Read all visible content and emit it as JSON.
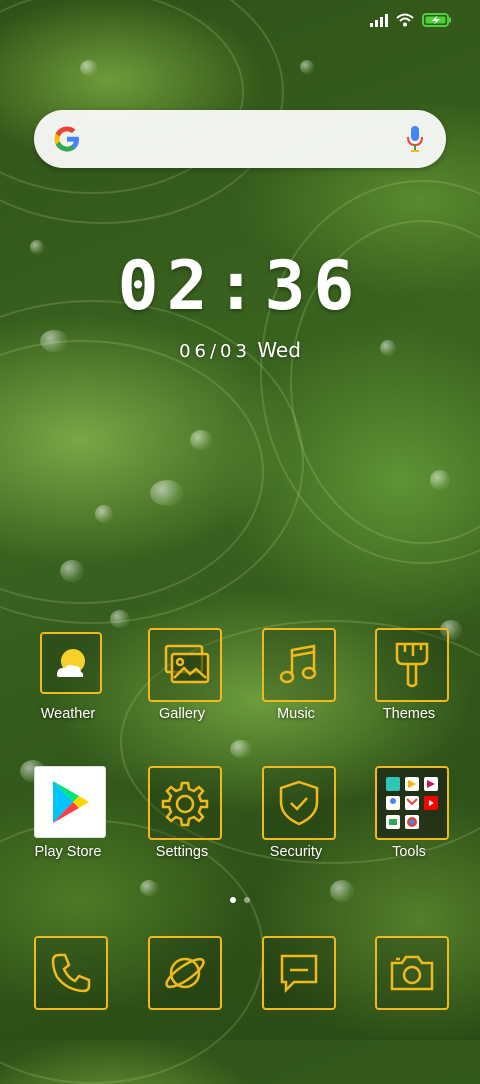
{
  "status": {
    "signal_icon": "signal-bars-icon",
    "wifi_icon": "wifi-icon",
    "battery_icon": "battery-charging-icon",
    "battery_color": "#4cd137"
  },
  "search": {
    "logo_icon": "google-g-icon",
    "mic_icon": "microphone-icon"
  },
  "clock": {
    "time": "02:36",
    "date": "06/03",
    "weekday": "Wed"
  },
  "accent": "#f3b91b",
  "apps_row1": [
    {
      "label": "Weather",
      "icon": "weather-sun-cloud-icon"
    },
    {
      "label": "Gallery",
      "icon": "gallery-images-icon"
    },
    {
      "label": "Music",
      "icon": "music-note-icon"
    },
    {
      "label": "Themes",
      "icon": "paintbrush-icon"
    }
  ],
  "apps_row2": [
    {
      "label": "Play Store",
      "icon": "play-store-icon"
    },
    {
      "label": "Settings",
      "icon": "gear-icon"
    },
    {
      "label": "Security",
      "icon": "shield-check-icon"
    },
    {
      "label": "Tools",
      "icon": "tools-folder-icon"
    }
  ],
  "dock": [
    {
      "icon": "phone-icon"
    },
    {
      "icon": "browser-planet-icon"
    },
    {
      "icon": "messages-icon"
    },
    {
      "icon": "camera-icon"
    }
  ],
  "pages": {
    "count": 2,
    "current": 1
  }
}
